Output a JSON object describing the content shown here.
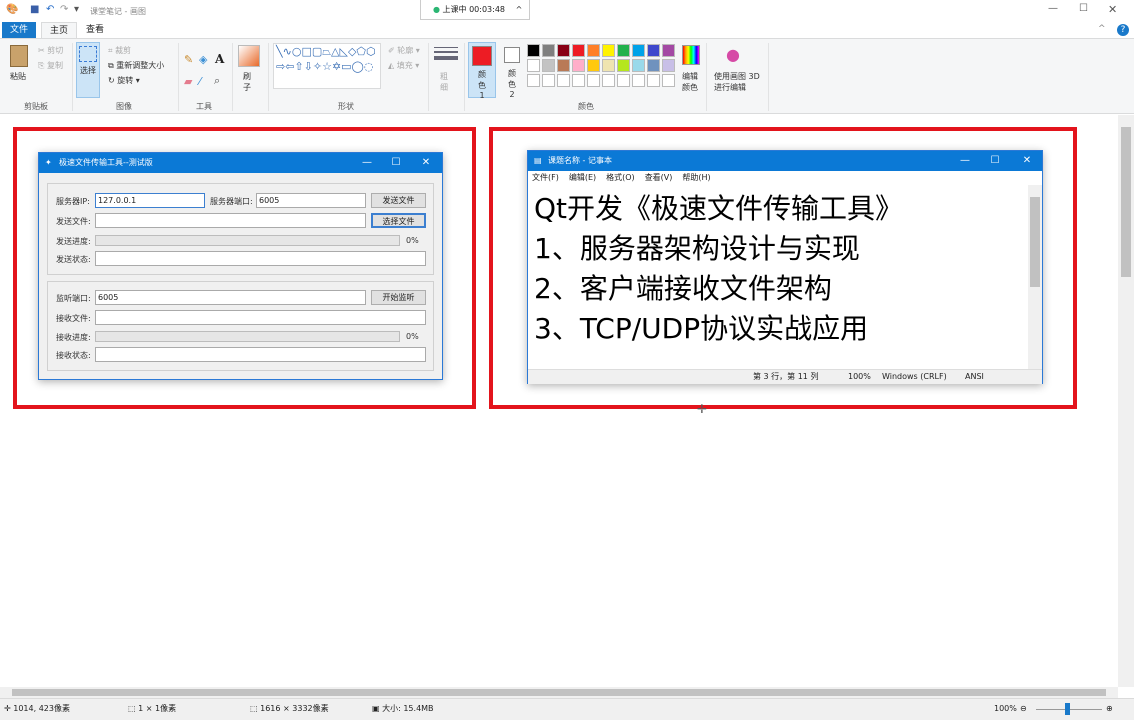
{
  "app": {
    "title": "课堂笔记 - 画图",
    "recording": "上课中 00:03:48"
  },
  "tabs": [
    "文件",
    "主页",
    "查看"
  ],
  "ribbon": {
    "clipboard": {
      "paste": "粘贴",
      "cut": "剪切",
      "copy": "复制",
      "group": "剪贴板"
    },
    "image": {
      "select": "选择",
      "crop": "裁剪",
      "resize": "重新调整大小",
      "rotate": "旋转",
      "group": "图像"
    },
    "tools": {
      "group": "工具"
    },
    "brush": {
      "label": "刷子"
    },
    "shapes": {
      "outline": "轮廓",
      "fill": "填充",
      "group": "形状",
      "glyphs": "╲∿○□▢⏢△◺◇⬠⬡⇨⇦⇧⇩✧☆✡▭◯◌"
    },
    "size": {
      "label": "粗细"
    },
    "color1": {
      "label": "颜色 1",
      "value": "#ed1c24"
    },
    "color2": {
      "label": "颜色 2",
      "value": "#ffffff"
    },
    "palette": [
      "#000000",
      "#7f7f7f",
      "#880015",
      "#ed1c24",
      "#ff7f27",
      "#fff200",
      "#22b14c",
      "#00a2e8",
      "#3f48cc",
      "#a349a4",
      "#ffffff",
      "#c3c3c3",
      "#b97a57",
      "#ffaec9",
      "#ffc90e",
      "#efe4b0",
      "#b5e61d",
      "#99d9ea",
      "#7092be",
      "#c8bfe7"
    ],
    "edit_colors": "编辑颜色",
    "paint3d": "使用画图 3D 进行编辑",
    "colors_group": "颜色"
  },
  "qt": {
    "title": "极速文件传输工具--测试版",
    "server_ip_label": "服务器IP:",
    "server_ip": "127.0.0.1",
    "server_port_label": "服务器端口:",
    "server_port": "6005",
    "send_button": "发送文件",
    "send_file_label": "发送文件:",
    "select_button": "选择文件",
    "send_progress_label": "发送进度:",
    "send_progress": "0%",
    "send_status_label": "发送状态:",
    "listen_port_label": "监听端口:",
    "listen_port": "6005",
    "listen_button": "开始监听",
    "recv_file_label": "接收文件:",
    "recv_progress_label": "接收进度:",
    "recv_progress": "0%",
    "recv_status_label": "接收状态:"
  },
  "notepad": {
    "title": "课题名称 - 记事本",
    "menu": [
      "文件(F)",
      "编辑(E)",
      "格式(O)",
      "查看(V)",
      "帮助(H)"
    ],
    "lines": [
      "Qt开发《极速文件传输工具》",
      "1、服务器架构设计与实现",
      "2、客户端接收文件架构",
      "3、TCP/UDP协议实战应用"
    ],
    "status": {
      "pos": "第 3 行，第 11 列",
      "zoom": "100%",
      "eol": "Windows (CRLF)",
      "enc": "ANSI"
    }
  },
  "statusbar": {
    "cursor": "1014, 423像素",
    "selection": "1 × 1像素",
    "size": "1616 × 3332像素",
    "filesize": "大小: 15.4MB",
    "zoom": "100%"
  }
}
